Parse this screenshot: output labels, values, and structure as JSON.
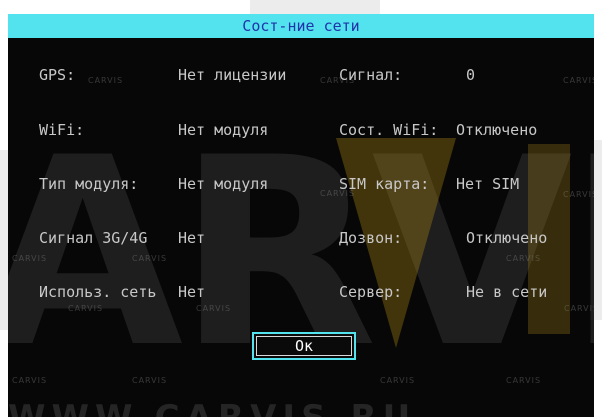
{
  "dialog": {
    "title": "Сост-ние сети"
  },
  "rows": [
    {
      "left_label": "GPS:",
      "left_value": "Нет лицензии",
      "right_label": "Сигнал:",
      "right_value": "0"
    },
    {
      "left_label": "WiFi:",
      "left_value": "Нет модуля",
      "right_label": "Сост. WiFi:",
      "right_value": "Отключено"
    },
    {
      "left_label": "Тип модуля:",
      "left_value": "Нет модуля",
      "right_label": "SIM карта:",
      "right_value": "Нет SIM"
    },
    {
      "left_label": "Сигнал 3G/4G",
      "left_value": "Нет",
      "right_label": "Дозвон:",
      "right_value": "Отключено"
    },
    {
      "left_label": "Использ. сеть",
      "left_value": "Нет",
      "right_label": "Сервер:",
      "right_value": "Не в сети"
    }
  ],
  "ok_button": {
    "label": "Ок"
  },
  "watermark": {
    "large_text": "ARVI",
    "small_text": "CARVIS",
    "bottom_text": "WWW.CARVIS.RU"
  },
  "colors": {
    "title_bar": "#52e3ee",
    "title_text": "#2233aa",
    "dialog_background": "#070707",
    "text": "#c8c8c8",
    "button_border": "#52e3ee"
  }
}
